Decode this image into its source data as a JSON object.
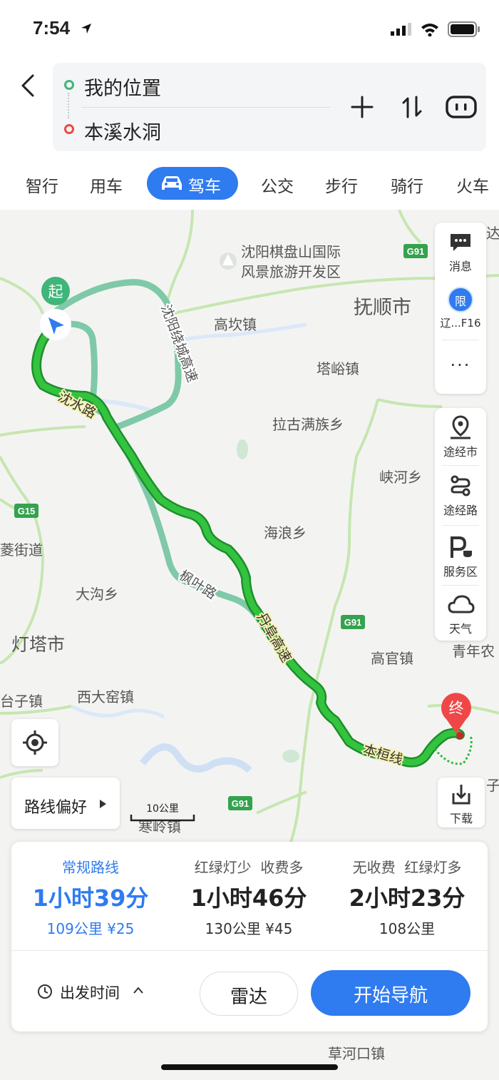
{
  "status_bar": {
    "time": "7:54"
  },
  "route": {
    "origin": "我的位置",
    "destination": "本溪水洞"
  },
  "tabs": [
    "智行",
    "用车",
    "驾车",
    "公交",
    "步行",
    "骑行",
    "火车"
  ],
  "active_tab": "驾车",
  "map_labels": {
    "scenic_area": "沈阳棋盘山国际风景旅游开发区",
    "scenic_area_line1": "沈阳棋盘山国际",
    "scenic_area_line2": "风景旅游开发区",
    "fushun": "抚顺市",
    "gaokan": "高坎镇",
    "tayu": "塔峪镇",
    "lagu": "拉古满族乡",
    "xiahe": "峡河乡",
    "hailang": "海浪乡",
    "dagou": "大沟乡",
    "dengta": "灯塔市",
    "taizi": "台子镇",
    "xidayao": "西大窑镇",
    "gaoguan": "高官镇",
    "qingnian": "青年农",
    "hanling": "寒岭镇",
    "caohekou": "草河口镇",
    "ling": "菱街道",
    "da": "达",
    "zi": "子",
    "road_shenshui": "沈水路",
    "road_raocheng": "沈阳绕城高速",
    "road_fengye": "枫叶路",
    "road_danfu": "丹阜高速",
    "road_benhuan": "本桓线",
    "g91": "G91",
    "g15": "G15",
    "start_marker": "起",
    "end_marker": "终",
    "scale": "10公里"
  },
  "sidebar": {
    "messages": "消息",
    "restriction_badge": "限",
    "restriction": "辽...F16",
    "via_city": "途经市",
    "via_road": "途经路",
    "service_area": "服务区",
    "weather": "天气",
    "download": "下载"
  },
  "route_preference": "路线偏好",
  "route_options": [
    {
      "label": "常规路线",
      "duration": "1小时39分",
      "meta": "109公里 ¥25",
      "selected": true
    },
    {
      "label": "红绿灯少  收费多",
      "duration": "1小时46分",
      "meta": "130公里 ¥45",
      "selected": false
    },
    {
      "label": "无收费  红绿灯多",
      "duration": "2小时23分",
      "meta": "108公里",
      "selected": false
    }
  ],
  "depart_time": "出发时间",
  "radar": "雷达",
  "start_navigation": "开始导航",
  "colors": {
    "accent": "#2f7bf0",
    "route_main": "#2ebd3c",
    "route_alt": "#7fc9a8",
    "start": "#3fb57a",
    "end": "#ef4747"
  }
}
